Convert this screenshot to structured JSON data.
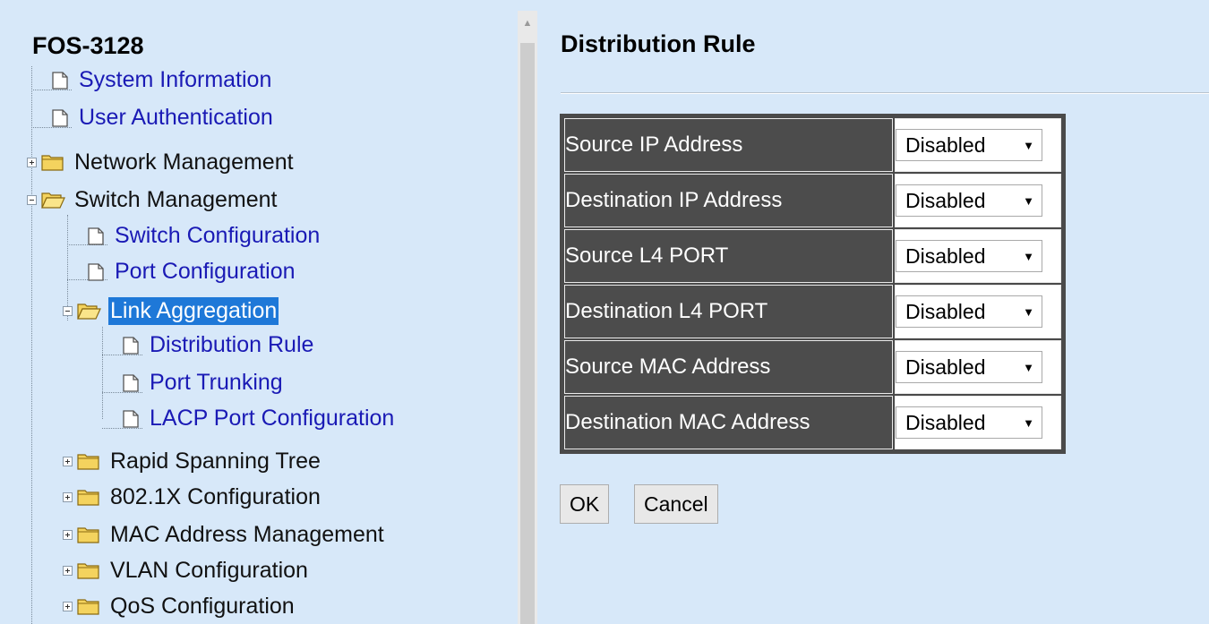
{
  "nav": {
    "title": "FOS-3128",
    "items": [
      {
        "label": "System Information"
      },
      {
        "label": "User Authentication"
      },
      {
        "label": "Network Management"
      },
      {
        "label": "Switch Management"
      },
      {
        "label": "Switch Configuration"
      },
      {
        "label": "Port Configuration"
      },
      {
        "label": "Link Aggregation"
      },
      {
        "label": "Distribution Rule"
      },
      {
        "label": "Port Trunking"
      },
      {
        "label": "LACP Port Configuration"
      },
      {
        "label": "Rapid Spanning Tree"
      },
      {
        "label": "802.1X Configuration"
      },
      {
        "label": "MAC Address Management"
      },
      {
        "label": "VLAN Configuration"
      },
      {
        "label": "QoS Configuration"
      }
    ]
  },
  "page": {
    "title": "Distribution Rule"
  },
  "rules": [
    {
      "label": "Source IP Address",
      "value": "Disabled"
    },
    {
      "label": "Destination IP Address",
      "value": "Disabled"
    },
    {
      "label": "Source L4 PORT",
      "value": "Disabled"
    },
    {
      "label": "Destination L4 PORT",
      "value": "Disabled"
    },
    {
      "label": "Source MAC Address",
      "value": "Disabled"
    },
    {
      "label": "Destination MAC Address",
      "value": "Disabled"
    }
  ],
  "buttons": {
    "ok": "OK",
    "cancel": "Cancel"
  },
  "colors": {
    "background": "#d7e8f9",
    "link": "#1a1ab5",
    "selected": "#1e78d8",
    "table_header": "#4c4c4c"
  }
}
